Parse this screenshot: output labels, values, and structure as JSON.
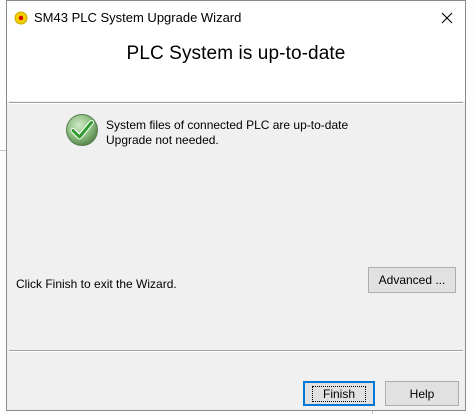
{
  "window": {
    "title": "SM43 PLC System Upgrade Wizard",
    "close_glyph": "✕"
  },
  "header": {
    "title": "PLC System is up-to-date"
  },
  "status": {
    "icon": "green-checkmark-icon",
    "line1": "System files of connected PLC are up-to-date",
    "line2": "Upgrade not needed."
  },
  "footer": {
    "hint": "Click Finish to exit the Wizard.",
    "advanced_label": "Advanced ...",
    "finish_label": "Finish",
    "help_label": "Help"
  },
  "colors": {
    "accent": "#0078d7",
    "check_green": "#3aa63a"
  }
}
